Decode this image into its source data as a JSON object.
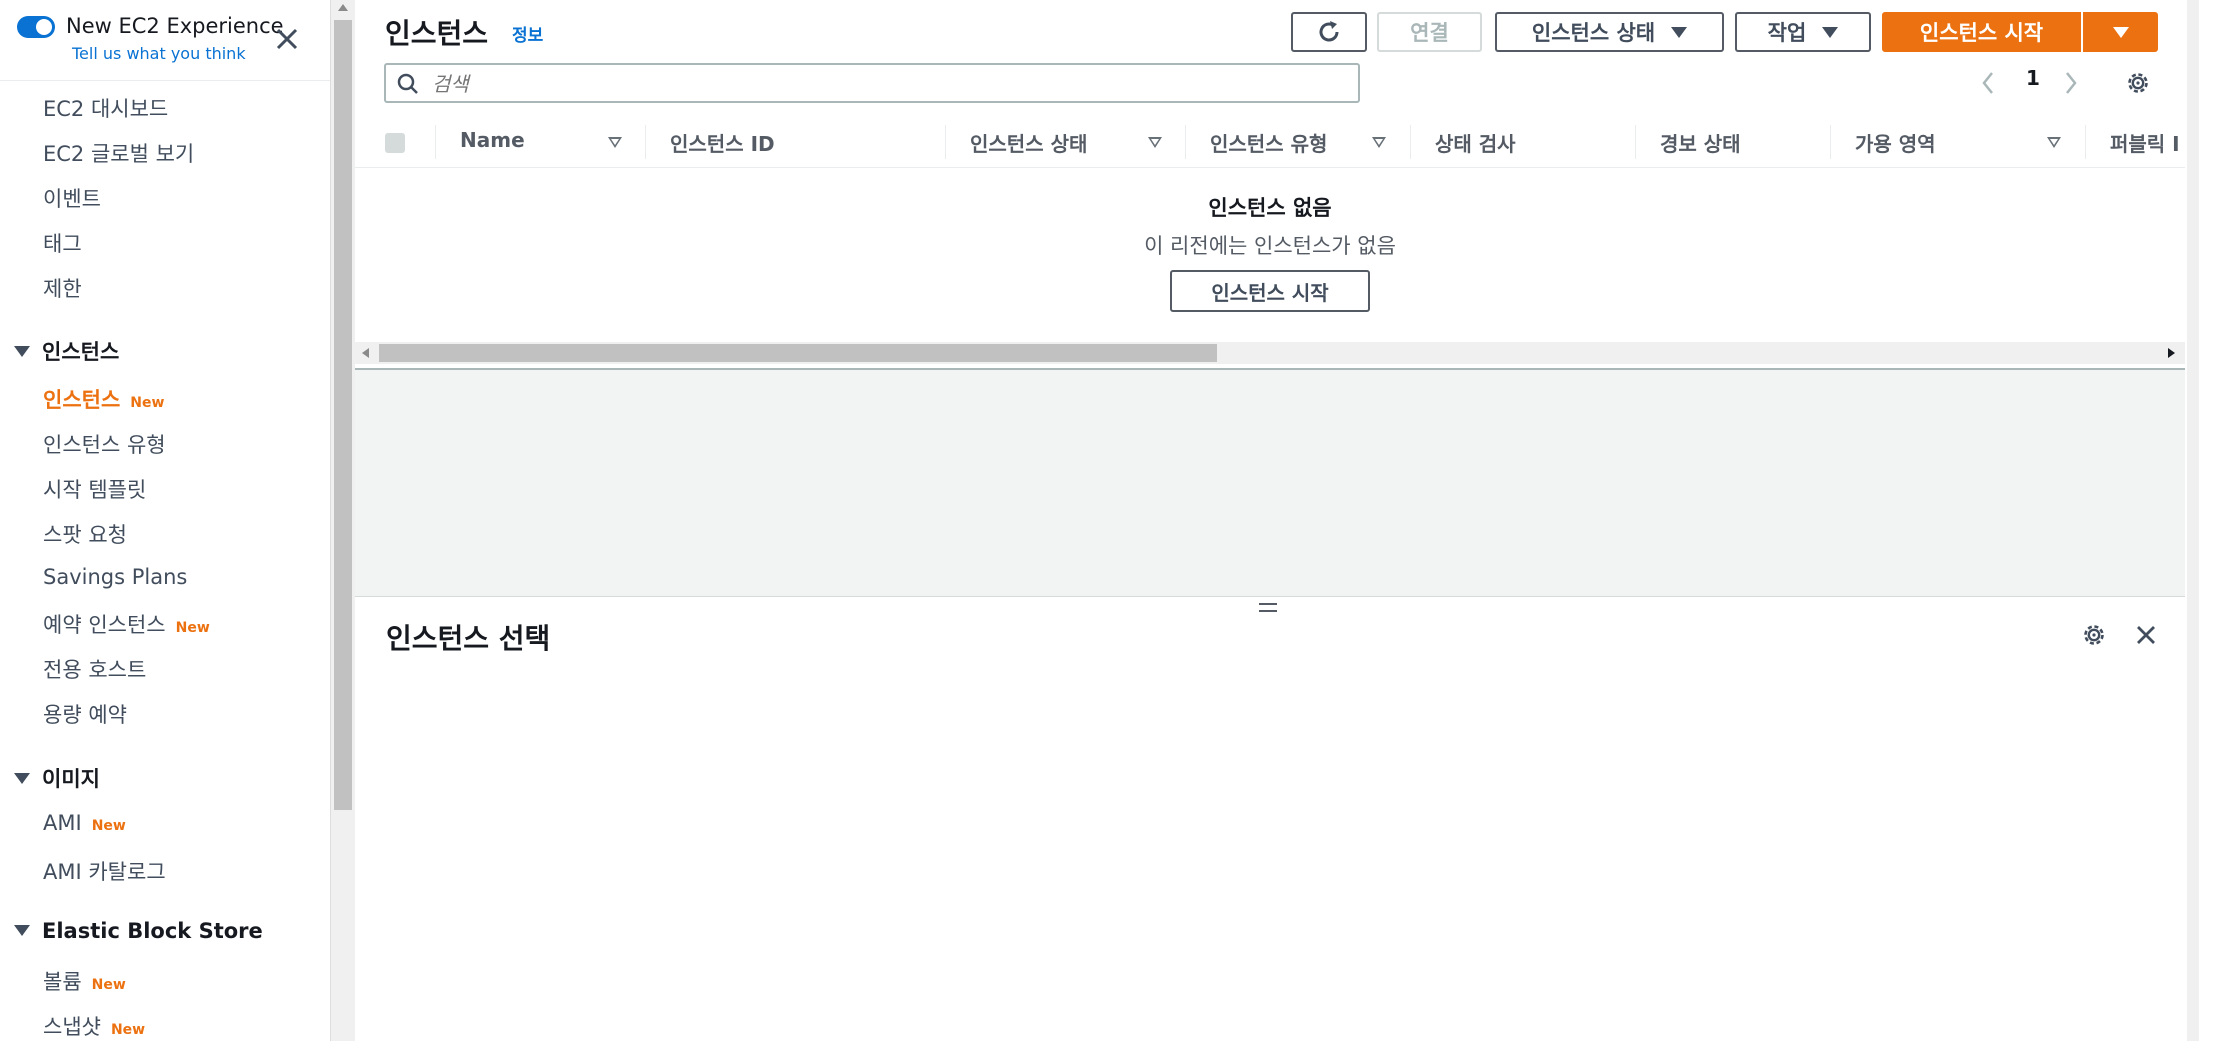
{
  "experience": {
    "title": "New EC2 Experience",
    "link": "Tell us what you think"
  },
  "sidebar": {
    "top_items": [
      "EC2 대시보드",
      "EC2 글로벌 보기",
      "이벤트",
      "태그",
      "제한"
    ],
    "sections": [
      {
        "title": "인스턴스",
        "items": [
          {
            "label": "인스턴스",
            "badge": "New",
            "active": true
          },
          {
            "label": "인스턴스 유형"
          },
          {
            "label": "시작 템플릿"
          },
          {
            "label": "스팟 요청"
          },
          {
            "label": "Savings Plans"
          },
          {
            "label": "예약 인스턴스",
            "badge": "New"
          },
          {
            "label": "전용 호스트"
          },
          {
            "label": "용량 예약"
          }
        ]
      },
      {
        "title": "이미지",
        "items": [
          {
            "label": "AMI",
            "badge": "New"
          },
          {
            "label": "AMI 카탈로그"
          }
        ]
      },
      {
        "title": "Elastic Block Store",
        "items": [
          {
            "label": "볼륨",
            "badge": "New"
          },
          {
            "label": "스냅샷",
            "badge": "New"
          }
        ]
      }
    ]
  },
  "header": {
    "title": "인스턴스",
    "info": "정보",
    "connect": "연결",
    "instance_state": "인스턴스 상태",
    "actions": "작업",
    "launch": "인스턴스 시작"
  },
  "search": {
    "placeholder": "검색"
  },
  "pagination": {
    "page": "1"
  },
  "table": {
    "columns": [
      "Name",
      "인스턴스 ID",
      "인스턴스 상태",
      "인스턴스 유형",
      "상태 검사",
      "경보 상태",
      "가용 영역",
      "퍼블릭 I"
    ],
    "empty_title": "인스턴스 없음",
    "empty_desc": "이 리전에는 인스턴스가 없음",
    "empty_button": "인스턴스 시작"
  },
  "split_panel": {
    "title": "인스턴스 선택"
  },
  "colors": {
    "accent": "#ec7211",
    "link": "#0972d3",
    "text": "#16191f"
  }
}
